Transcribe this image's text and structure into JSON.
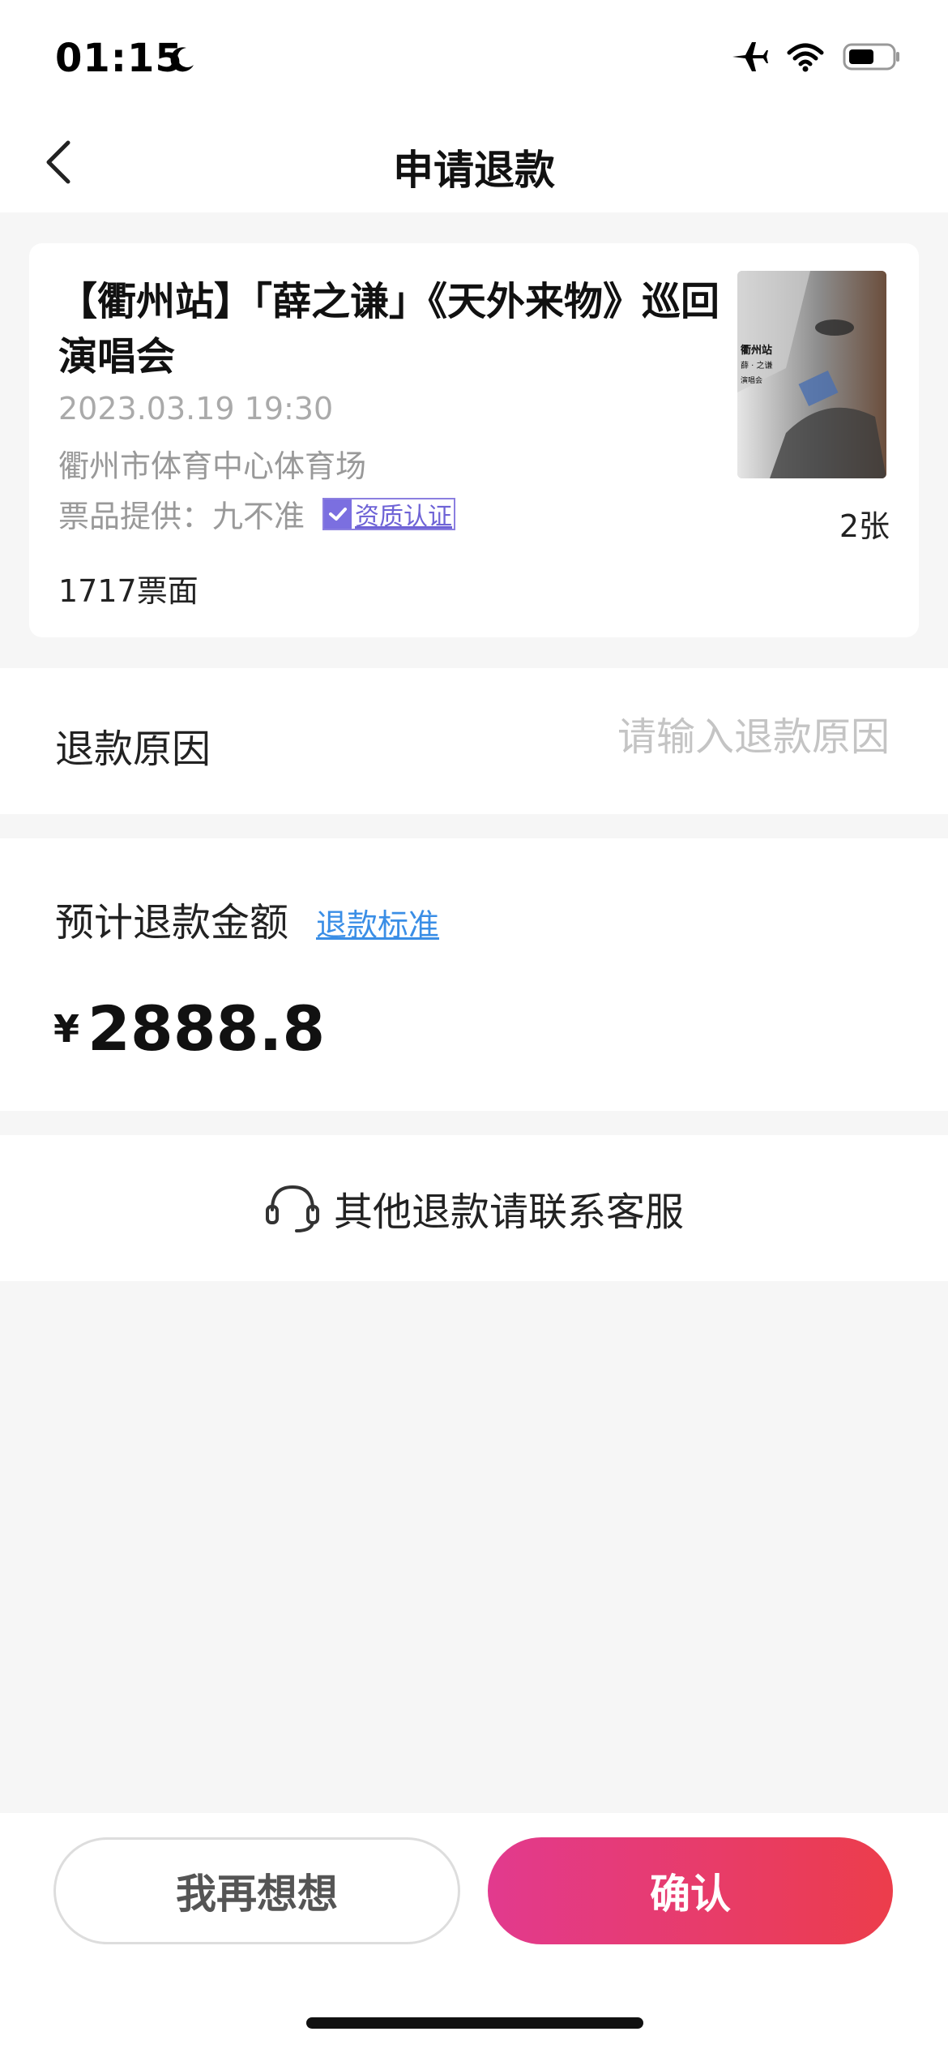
{
  "status_bar": {
    "time": "01:15"
  },
  "nav": {
    "title": "申请退款"
  },
  "event": {
    "title": "【衢州站】「薛之谦」《天外来物》巡回演唱会",
    "datetime": "2023.03.19 19:30",
    "venue": "衢州市体育中心体育场",
    "provider": "票品提供：九不准",
    "cert_label": "资质认证",
    "face_value": "1717票面",
    "quantity": "2张",
    "poster_text": {
      "line1": "衢州站",
      "line2": "薛 · 之谦",
      "line3": "演唱会"
    }
  },
  "refund_reason": {
    "label": "退款原因",
    "placeholder": "请输入退款原因",
    "value": ""
  },
  "refund_amount": {
    "label": "预计退款金额",
    "link": "退款标准",
    "currency": "¥",
    "amount": "2888.8"
  },
  "contact": {
    "label": "其他退款请联系客服"
  },
  "buttons": {
    "cancel": "我再想想",
    "confirm": "确认"
  },
  "colors": {
    "accent_start": "#e23a8e",
    "accent_end": "#ec3d4b",
    "link": "#3a8ee6",
    "cert": "#7b6fe0"
  }
}
